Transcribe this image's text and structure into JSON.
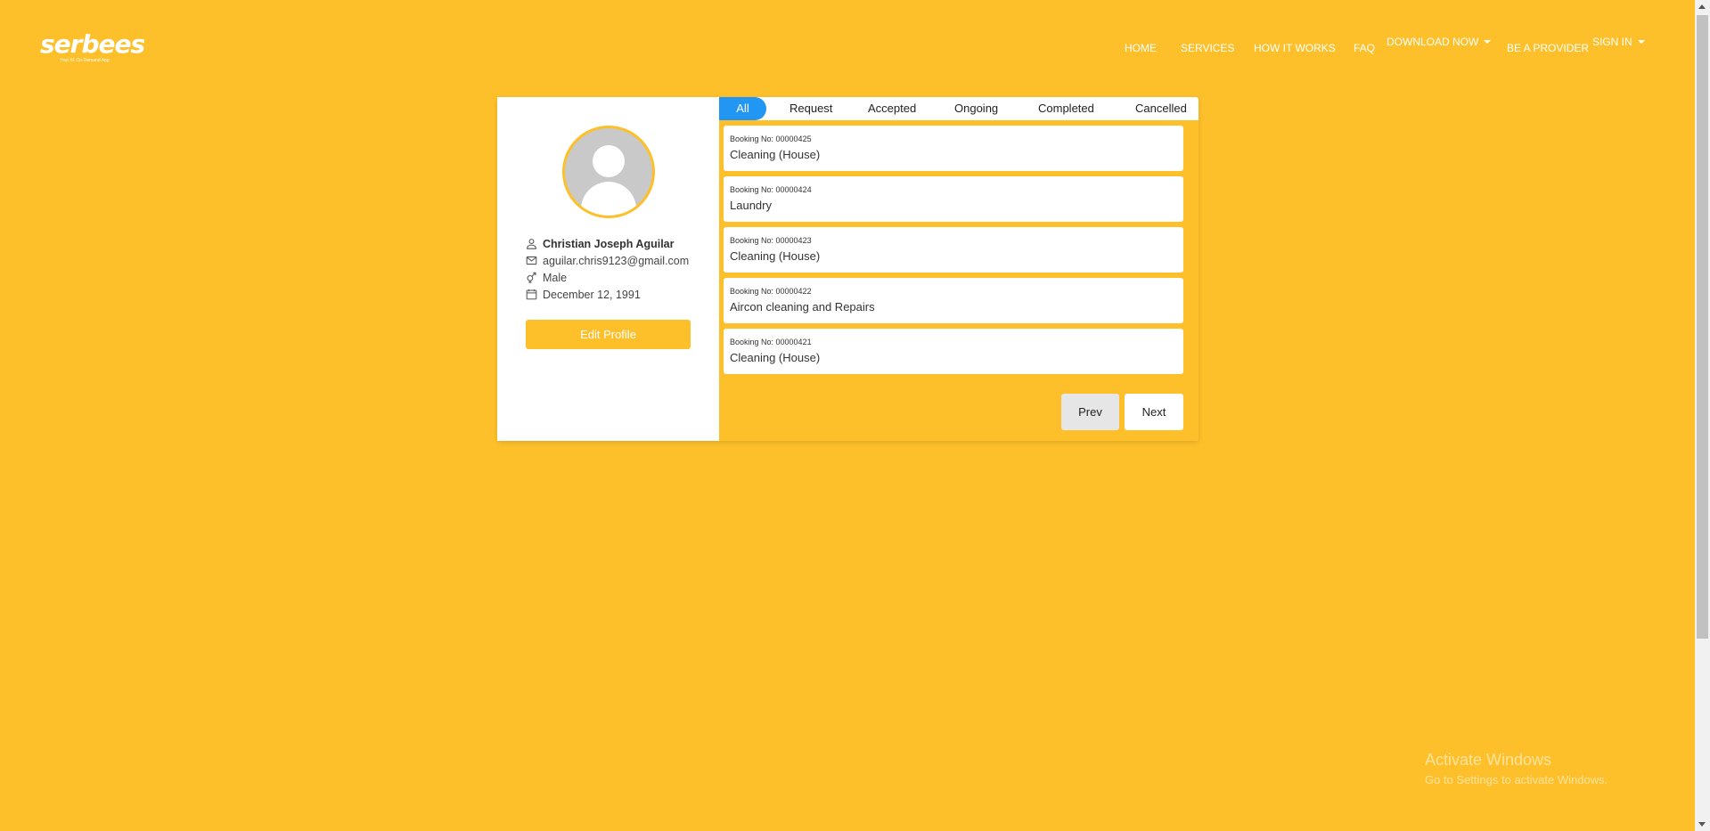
{
  "brand": {
    "name": "serbees",
    "tagline": "Your #1 On-Demand App"
  },
  "nav": {
    "home": "HOME",
    "services": "SERVICES",
    "how": "HOW IT WORKS",
    "faq": "FAQ",
    "download": "DOWNLOAD NOW",
    "provider": "BE A PROVIDER",
    "signin": "SIGN IN"
  },
  "profile": {
    "name": "Christian Joseph Aguilar",
    "email": "aguilar.chris9123@gmail.com",
    "gender": "Male",
    "birthday": "December 12, 1991",
    "edit_label": "Edit Profile"
  },
  "tabs": [
    "All",
    "Request",
    "Accepted",
    "Ongoing",
    "Completed",
    "Cancelled"
  ],
  "bookings": [
    {
      "number": "Booking No: 00000425",
      "service": "Cleaning (House)"
    },
    {
      "number": "Booking No: 00000424",
      "service": "Laundry"
    },
    {
      "number": "Booking No: 00000423",
      "service": "Cleaning (House)"
    },
    {
      "number": "Booking No: 00000422",
      "service": "Aircon cleaning and Repairs"
    },
    {
      "number": "Booking No: 00000421",
      "service": "Cleaning (House)"
    }
  ],
  "pager": {
    "prev": "Prev",
    "next": "Next"
  },
  "watermark": {
    "title": "Activate Windows",
    "subtitle": "Go to Settings to activate Windows."
  },
  "colors": {
    "background": "#FEC02A",
    "active_tab": "#2196F3"
  }
}
